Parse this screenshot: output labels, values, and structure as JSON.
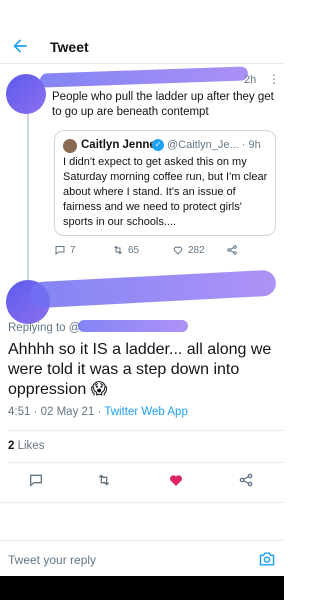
{
  "header": {
    "title": "Tweet",
    "back_icon": "arrow-left-icon"
  },
  "parent_tweet": {
    "time": "2h",
    "more": "⋮",
    "text": "People who pull the ladder up after they get to go up are beneath contempt",
    "quote": {
      "name": "Caitlyn Jenner",
      "handle": "@Caitlyn_Je... · 9h",
      "text": "I didn't expect to get asked this on my Saturday morning coffee run, but I'm clear about where I stand. It's an issue of fairness and we need to protect girls' sports in our schools...."
    },
    "actions": {
      "replies": "7",
      "retweets": "65",
      "likes": "282"
    }
  },
  "main_tweet": {
    "replying_to": "Replying to @",
    "text": "Ahhhh so it IS a ladder... all along we were told it was a step down into oppression 😱",
    "timestamp": "4:51 · 02 May 21 · ",
    "app": "Twitter Web App",
    "likes_count": "2",
    "likes_label": "Likes"
  },
  "reply_bar": {
    "placeholder": "Tweet your reply"
  },
  "colors": {
    "accent": "#1da1f2",
    "like": "#e0245e",
    "muted": "#657786"
  }
}
